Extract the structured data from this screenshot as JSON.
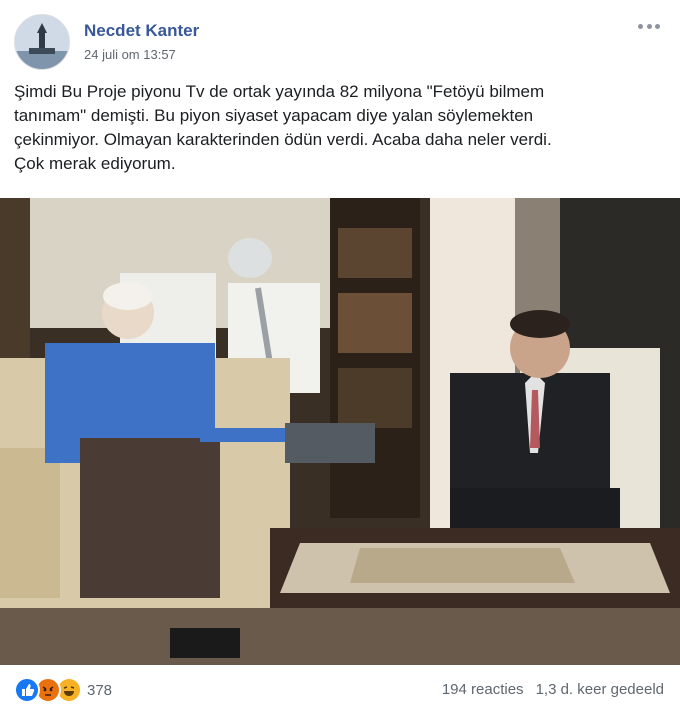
{
  "post": {
    "author": "Necdet Kanter",
    "timestamp": "24 juli om 13:57",
    "text": "Şimdi Bu Proje piyonu Tv de ortak yayında 82 milyona \"Fetöyü bilmem\ntanımam\" demişti. Bu piyon siyaset yapacam diye yalan söylemekten\nçekinmiyor. Olmayan karakterinden ödün verdi. Acaba daha neler verdi.\nÇok merak ediyorum."
  },
  "footer": {
    "reaction_icons": [
      "like-icon",
      "angry-icon",
      "haha-icon"
    ],
    "reaction_count": "378",
    "comments": "194 reacties",
    "shares": "1,3 d. keer gedeeld"
  },
  "colors": {
    "author_link": "#385898",
    "meta_gray": "#606770",
    "like_blue": "#1877f2",
    "angry_orange": "#e9710f",
    "haha_yellow": "#f7b125"
  }
}
